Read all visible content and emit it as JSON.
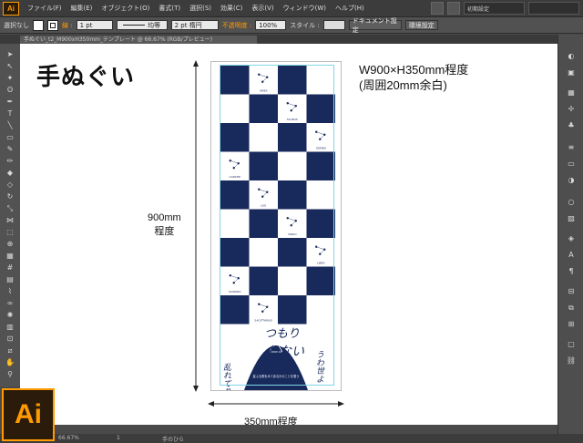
{
  "menubar": {
    "logo": "Ai",
    "items": [
      "ファイル(F)",
      "編集(E)",
      "オブジェクト(O)",
      "書式(T)",
      "選択(S)",
      "効果(C)",
      "表示(V)",
      "ウィンドウ(W)",
      "ヘルプ(H)"
    ],
    "workspace": "初期設定"
  },
  "controlbar": {
    "selection": "選択なし",
    "stroke_label": "線 :",
    "stroke_weight": "1 pt",
    "profile": "均等",
    "brush": "2 pt 楕円",
    "opacity_label": "不透明度 :",
    "opacity_value": "100%",
    "style_label": "スタイル :",
    "document_setup": "ドキュメント設定",
    "preferences": "環境設定"
  },
  "document_tab": {
    "title": "手ぬぐい_t2_M900xH350mm_テンプレート @ 66.67% (RGB/プレビュー)"
  },
  "artboard": {
    "title": "手ぬぐい",
    "spec_line1": "W900×H350mm程度",
    "spec_line2": "(周囲20mm余白)",
    "height_label_1": "900mm",
    "height_label_2": "程度",
    "width_label": "350mm程度",
    "checker_color": "#182a5c",
    "guide_color": "#7fd6e8",
    "illustration_lines": [
      "つもり",
      "わない",
      "乱れてり",
      "うわ世よ"
    ],
    "bottom_caption": "星ふる夜をみてあなたのことを想う",
    "constellations": [
      "ARIES",
      "TAURUS",
      "GEMINI",
      "CANCER",
      "LEO",
      "VIRGO",
      "LIBRA",
      "SCORPIO",
      "SAGITTARIUS",
      "CAPRICORN",
      "AQUARIUS",
      "PISCES"
    ]
  },
  "statusbar": {
    "zoom": "66.67%",
    "page": "1",
    "tool": "手のひら"
  },
  "branding": {
    "accent": "#ff9a00",
    "app_icon": "Ai"
  }
}
